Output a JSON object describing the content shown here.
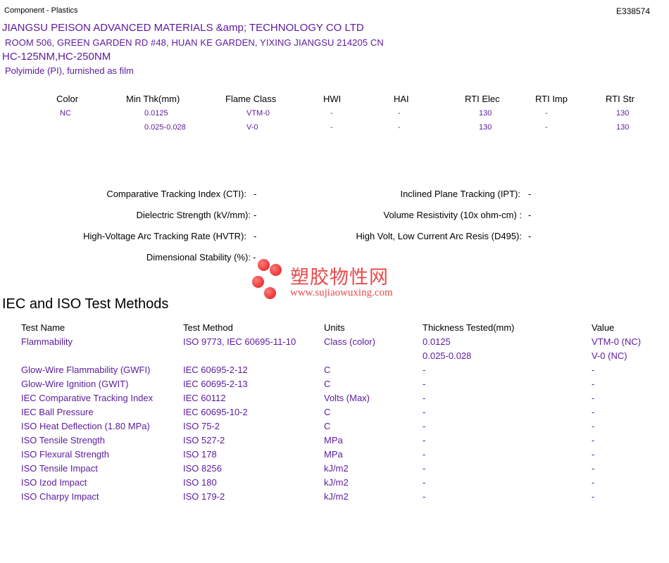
{
  "header": {
    "left": "Component - Plastics",
    "right": "E338574"
  },
  "company": {
    "name": "JIANGSU PEISON ADVANCED MATERIALS &amp; TECHNOLOGY CO LTD",
    "address": "ROOM 506, GREEN GARDEN RD #48, HUAN KE GARDEN, YIXING  JIANGSU  214205 CN",
    "products": "HC-125NM,HC-250NM",
    "material": "Polyimide (PI), furnished as film"
  },
  "ratings": {
    "headers": [
      "Color",
      "Min Thk(mm)",
      "Flame Class",
      "HWI",
      "HAI",
      "RTI Elec",
      "RTI Imp",
      "RTI Str"
    ],
    "rows": [
      [
        "NC",
        "0.0125",
        "VTM-0",
        "-",
        "-",
        "130",
        "-",
        "130"
      ],
      [
        "",
        "0.025-0.028",
        "V-0",
        "-",
        "-",
        "130",
        "-",
        "130"
      ]
    ]
  },
  "properties": {
    "left": [
      {
        "label": "Comparative Tracking Index (CTI):",
        "value": "-"
      },
      {
        "label": "Dielectric Strength (kV/mm):",
        "value": "-"
      },
      {
        "label": "High-Voltage Arc Tracking Rate (HVTR):",
        "value": "-"
      },
      {
        "label": "Dimensional Stability (%):",
        "value": "-"
      }
    ],
    "right": [
      {
        "label": "Inclined Plane Tracking (IPT):",
        "value": "-"
      },
      {
        "label": "Volume Resistivity (10x ohm-cm) :",
        "value": "-"
      },
      {
        "label": "High Volt, Low Current Arc Resis (D495):",
        "value": "-"
      }
    ]
  },
  "watermark": {
    "cn": "塑胶物性网",
    "url": "www.sujiaowuxing.com"
  },
  "iec": {
    "title": "IEC and ISO Test Methods",
    "headers": [
      "Test Name",
      "Test Method",
      "Units",
      "Thickness Tested(mm)",
      "Value"
    ],
    "rows": [
      [
        "Flammability",
        "ISO 9773, IEC 60695-11-10",
        "Class (color)",
        "0.0125",
        "VTM-0 (NC)"
      ],
      [
        "",
        "",
        "",
        "0.025-0.028",
        "V-0 (NC)"
      ],
      [
        "Glow-Wire Flammability (GWFI)",
        "IEC 60695-2-12",
        "C",
        "-",
        "-"
      ],
      [
        "Glow-Wire Ignition (GWIT)",
        "IEC 60695-2-13",
        "C",
        "-",
        "-"
      ],
      [
        "IEC Comparative Tracking Index",
        "IEC 60112",
        "Volts (Max)",
        "-",
        "-"
      ],
      [
        "IEC Ball Pressure",
        "IEC 60695-10-2",
        "C",
        "-",
        "-"
      ],
      [
        "ISO Heat Deflection (1.80 MPa)",
        "ISO 75-2",
        "C",
        "-",
        "-"
      ],
      [
        "ISO Tensile Strength",
        "ISO 527-2",
        "MPa",
        "-",
        "-"
      ],
      [
        "ISO Flexural Strength",
        "ISO 178",
        "MPa",
        "-",
        "-"
      ],
      [
        "ISO Tensile Impact",
        "ISO 8256",
        "kJ/m2",
        "-",
        "-"
      ],
      [
        "ISO Izod Impact",
        "ISO 180",
        "kJ/m2",
        "-",
        "-"
      ],
      [
        "ISO Charpy Impact",
        "ISO 179-2",
        "kJ/m2",
        "-",
        "-"
      ]
    ]
  }
}
